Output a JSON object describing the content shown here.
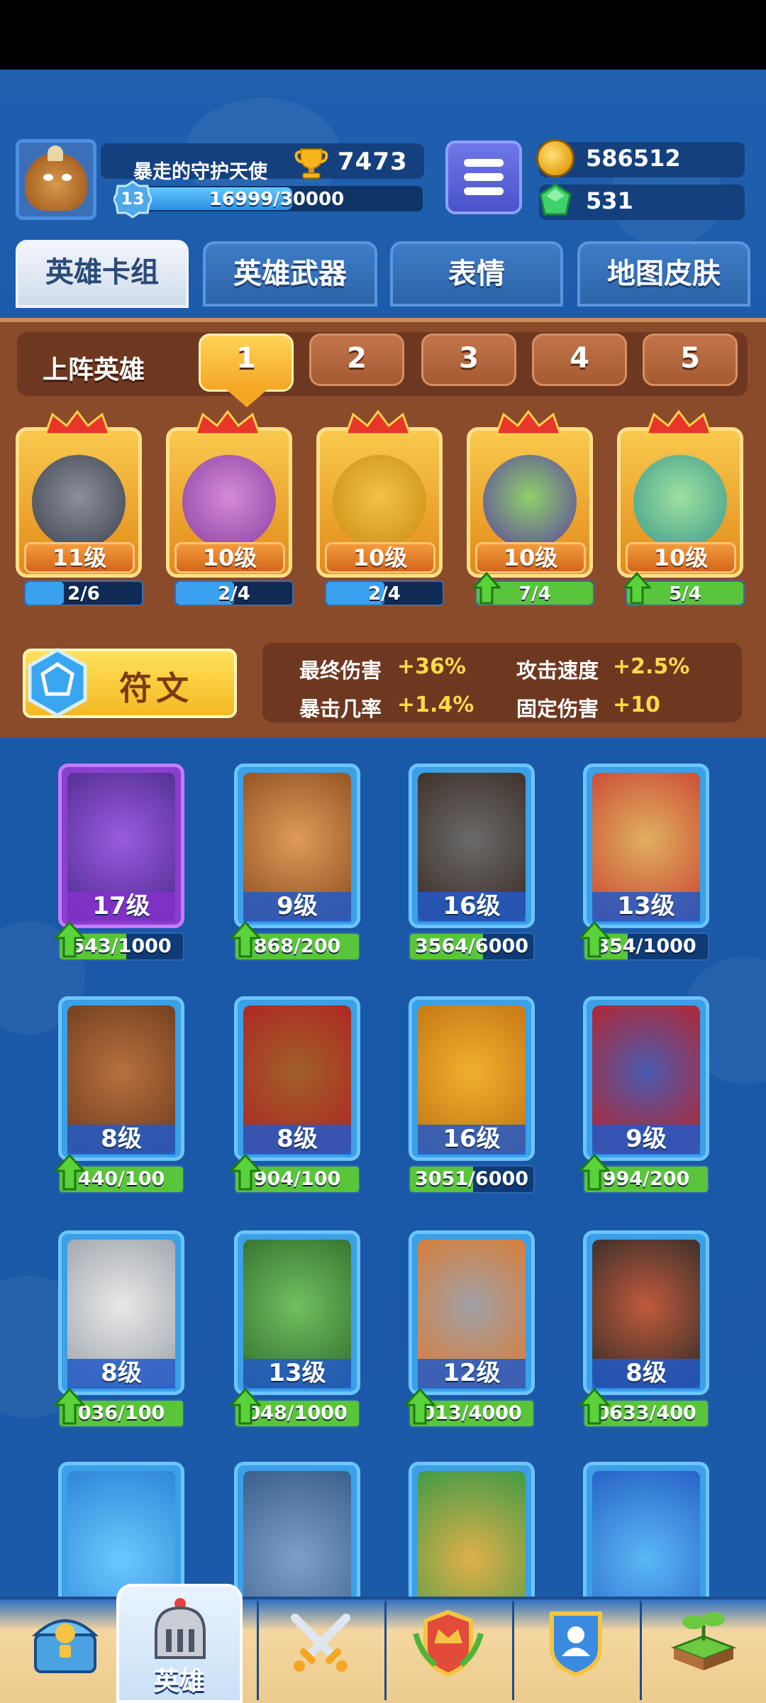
{
  "player": {
    "name": "暴走的守护天使",
    "trophies": "7473",
    "level": "13",
    "xp_text": "16999/30000",
    "xp_fraction": 0.567
  },
  "currency": {
    "coins": "586512",
    "gems": "531"
  },
  "tabs": [
    {
      "label": "英雄卡组",
      "active": true
    },
    {
      "label": "英雄武器",
      "active": false
    },
    {
      "label": "表情",
      "active": false
    },
    {
      "label": "地图皮肤",
      "active": false
    }
  ],
  "deck": {
    "label": "上阵英雄",
    "slots": [
      "1",
      "2",
      "3",
      "4",
      "5"
    ],
    "active_slot": "1",
    "heroes": [
      {
        "level": "11级",
        "progress": "2/6",
        "fraction": 0.33,
        "upgradable": false
      },
      {
        "level": "10级",
        "progress": "2/4",
        "fraction": 0.5,
        "upgradable": false
      },
      {
        "level": "10级",
        "progress": "2/4",
        "fraction": 0.5,
        "upgradable": false
      },
      {
        "level": "10级",
        "progress": "7/4",
        "fraction": 1,
        "upgradable": true
      },
      {
        "level": "10级",
        "progress": "5/4",
        "fraction": 1,
        "upgradable": true
      }
    ]
  },
  "rune": {
    "label": "符文",
    "stats": [
      {
        "label": "最终伤害",
        "value": "+36%"
      },
      {
        "label": "攻击速度",
        "value": "+2.5%"
      },
      {
        "label": "暴击几率",
        "value": "+1.4%"
      },
      {
        "label": "固定伤害",
        "value": "+10"
      }
    ]
  },
  "heroes": [
    {
      "level": "17级",
      "progress": "543/1000",
      "fraction": 0.54,
      "upgradable": true,
      "rarity": "epic"
    },
    {
      "level": "9级",
      "progress": "868/200",
      "fraction": 1,
      "upgradable": true,
      "rarity": "rare"
    },
    {
      "level": "16级",
      "progress": "3564/6000",
      "fraction": 0.59,
      "upgradable": false,
      "rarity": "rare"
    },
    {
      "level": "13级",
      "progress": "354/1000",
      "fraction": 0.35,
      "upgradable": true,
      "rarity": "rare"
    },
    {
      "level": "8级",
      "progress": "440/100",
      "fraction": 1,
      "upgradable": true,
      "rarity": "rare"
    },
    {
      "level": "8级",
      "progress": "904/100",
      "fraction": 1,
      "upgradable": true,
      "rarity": "rare"
    },
    {
      "level": "16级",
      "progress": "3051/6000",
      "fraction": 0.51,
      "upgradable": false,
      "rarity": "rare"
    },
    {
      "level": "9级",
      "progress": "994/200",
      "fraction": 1,
      "upgradable": true,
      "rarity": "rare"
    },
    {
      "level": "8级",
      "progress": "036/100",
      "fraction": 1,
      "upgradable": true,
      "rarity": "rare"
    },
    {
      "level": "13级",
      "progress": "048/1000",
      "fraction": 1,
      "upgradable": true,
      "rarity": "rare"
    },
    {
      "level": "12级",
      "progress": "013/4000",
      "fraction": 1,
      "upgradable": true,
      "rarity": "rare"
    },
    {
      "level": "8级",
      "progress": "0633/400",
      "fraction": 1,
      "upgradable": true,
      "rarity": "rare"
    }
  ],
  "bottom_nav": [
    {
      "icon": "treasure-chest-icon",
      "label": ""
    },
    {
      "icon": "knight-helmet-icon",
      "label": "英雄",
      "active": true
    },
    {
      "icon": "crossed-swords-icon",
      "label": ""
    },
    {
      "icon": "crown-shield-icon",
      "label": ""
    },
    {
      "icon": "guild-icon",
      "label": ""
    },
    {
      "icon": "sprout-island-icon",
      "label": ""
    }
  ],
  "colors": {
    "accent_gold": "#f5a623",
    "progress_green": "#58c53a",
    "progress_blue": "#2a8fe0",
    "panel_brown": "#8a4b2b"
  }
}
